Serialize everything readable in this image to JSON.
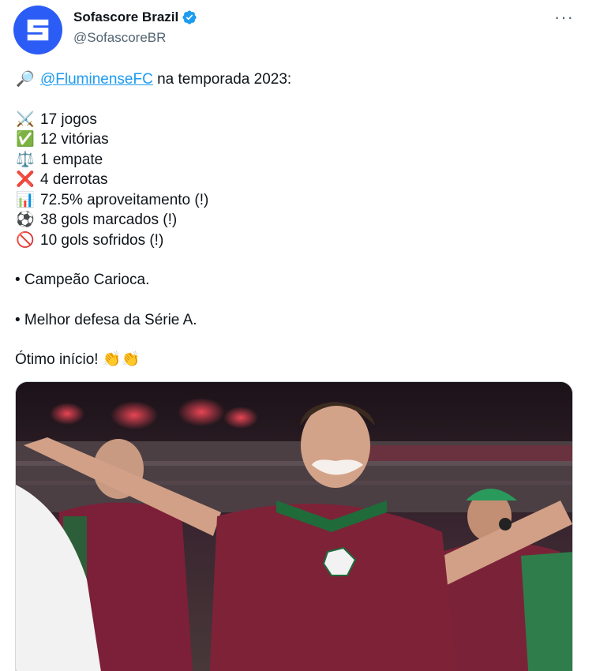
{
  "author": {
    "display_name": "Sofascore Brazil",
    "handle": "@SofascoreBR",
    "verified": true,
    "avatar_color": "#2c5cf6"
  },
  "more_button": "more-horizontal-icon",
  "tweet": {
    "intro_prefix": "🔎",
    "mention": "@FluminenseFC",
    "intro_suffix": " na temporada 2023:",
    "stats": [
      {
        "icon": "crossed-swords-icon",
        "emoji": "⚔️",
        "text": "17 jogos"
      },
      {
        "icon": "check-mark-icon",
        "emoji": "✅",
        "text": "12 vitórias"
      },
      {
        "icon": "balance-scale-icon",
        "emoji": "⚖️",
        "text": "1 empate"
      },
      {
        "icon": "cross-mark-icon",
        "emoji": "❌",
        "text": "4 derrotas"
      },
      {
        "icon": "bar-chart-icon",
        "emoji": "📊",
        "text": "72.5% aproveitamento (!)"
      },
      {
        "icon": "soccer-ball-icon",
        "emoji": "⚽",
        "text": "38 gols marcados (!)"
      },
      {
        "icon": "prohibited-icon",
        "emoji": "🚫",
        "text": "10 gols sofridos (!)"
      }
    ],
    "bullet1": "• Campeão Carioca.",
    "bullet2": "• Melhor defesa da Série A.",
    "closing": "Ótimo início! ",
    "closing_emoji": "👏👏"
  },
  "media": {
    "type": "photo",
    "subject": "coach-celebrating-in-stadium"
  },
  "colors": {
    "link": "#1d9bf0",
    "secondary_text": "#536471",
    "verified_badge": "#1d9bf0"
  }
}
